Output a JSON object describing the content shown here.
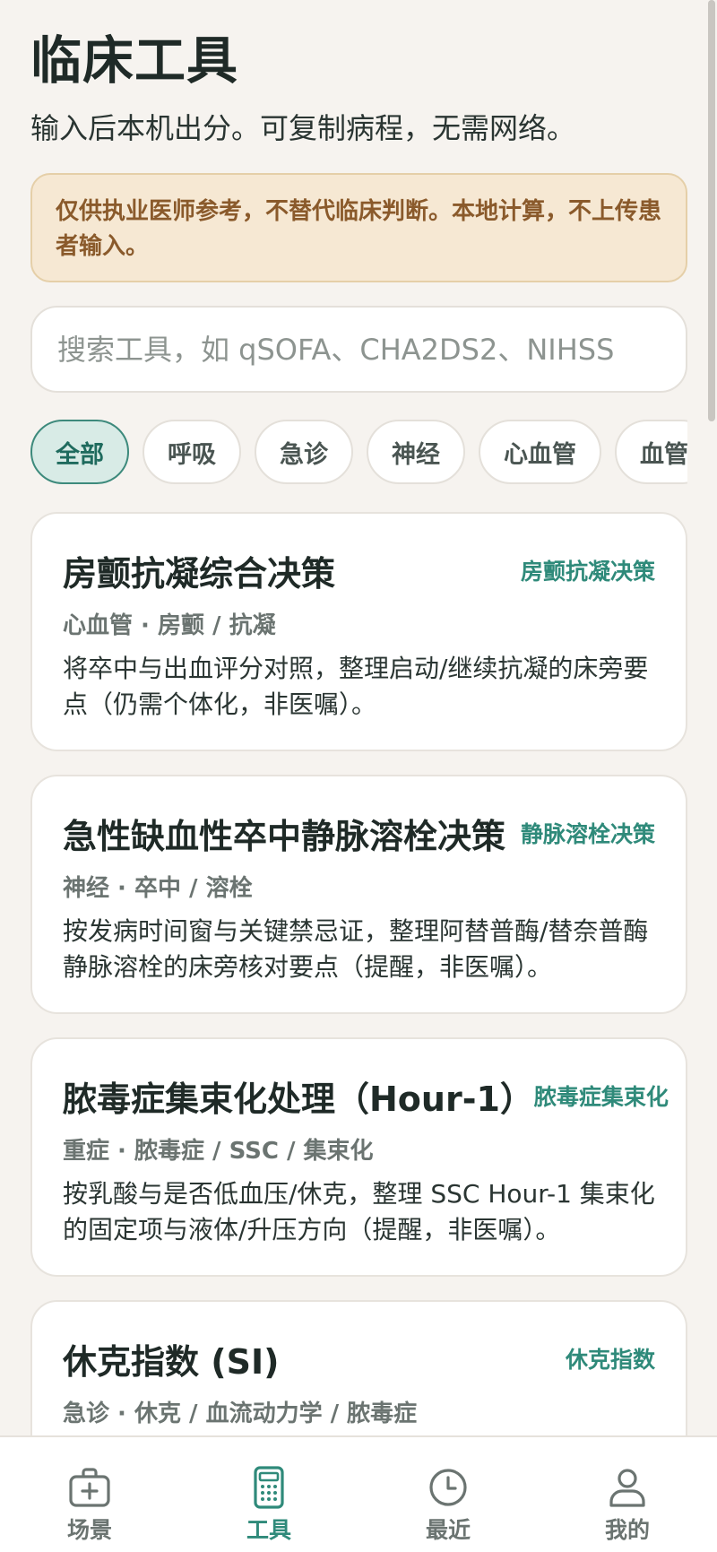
{
  "header": {
    "title": "临床工具",
    "subtitle": "输入后本机出分。可复制病程，无需网络。"
  },
  "disclaimer": "仅供执业医师参考，不替代临床判断。本地计算，不上传患者输入。",
  "search": {
    "placeholder": "搜索工具，如 qSOFA、CHA2DS2、NIHSS",
    "value": ""
  },
  "filters": [
    {
      "label": "全部",
      "active": true
    },
    {
      "label": "呼吸",
      "active": false
    },
    {
      "label": "急诊",
      "active": false
    },
    {
      "label": "神经",
      "active": false
    },
    {
      "label": "心血管",
      "active": false
    },
    {
      "label": "血管",
      "active": false
    }
  ],
  "cards": [
    {
      "title": "房颤抗凝综合决策",
      "badge": "房颤抗凝决策",
      "tags": "心血管 · 房颤 / 抗凝",
      "desc": "将卒中与出血评分对照，整理启动/继续抗凝的床旁要点（仍需个体化，非医嘱）。"
    },
    {
      "title": "急性缺血性卒中静脉溶栓决策",
      "badge": "静脉溶栓决策",
      "tags": "神经 · 卒中 / 溶栓",
      "desc": "按发病时间窗与关键禁忌证，整理阿替普酶/替奈普酶静脉溶栓的床旁核对要点（提醒，非医嘱）。"
    },
    {
      "title": "脓毒症集束化处理（Hour-1）",
      "badge": "脓毒症集束化",
      "tags": "重症 · 脓毒症 / SSC / 集束化",
      "desc": "按乳酸与是否低血压/休克，整理 SSC Hour-1 集束化的固定项与液体/升压方向（提醒，非医嘱）。"
    },
    {
      "title": "休克指数 (SI)",
      "badge": "休克指数",
      "tags": "急诊 · 休克 / 血流动力学 / 脓毒症",
      "desc": ""
    }
  ],
  "tabbar": [
    {
      "label": "场景",
      "icon": "medical-kit-icon",
      "active": false
    },
    {
      "label": "工具",
      "icon": "calculator-icon",
      "active": true
    },
    {
      "label": "最近",
      "icon": "clock-icon",
      "active": false
    },
    {
      "label": "我的",
      "icon": "person-icon",
      "active": false
    }
  ],
  "colors": {
    "background": "#f6f3ef",
    "accent": "#2f8a7a",
    "warning_bg": "#f6e8d3",
    "warning_text": "#8a5a2b"
  }
}
